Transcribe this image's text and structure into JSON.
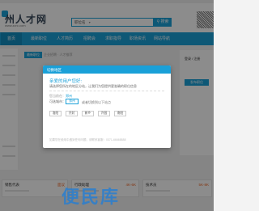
{
  "header": {
    "logo_text": "州人才网",
    "logo_url": "www.zzrc.com",
    "search_select": "职位名",
    "search_button": "搜索"
  },
  "nav": {
    "items": [
      "首页",
      "最新职位",
      "人才简历",
      "招聘会",
      "求职指导",
      "职场资讯",
      "网站导航"
    ]
  },
  "page": {
    "banner_tab": "最新职位",
    "banner_tab2": "企业招聘 · 人才推荐",
    "right_title": "登录 / 注册",
    "right_button": "发布职位"
  },
  "cards": [
    {
      "title": "销售代表",
      "salary": "面议"
    },
    {
      "title": "行政助理",
      "salary": "4K-6K"
    },
    {
      "title": "技术员",
      "salary": "5K-8K"
    }
  ],
  "dialog": {
    "title": "切换地区",
    "question": "亲爱的用户您好:",
    "description": "请选择您所在的地区分站，让我们为您提供更准确的职位信息",
    "current_label": "您当前在：",
    "current_city": "郑州",
    "city_label": "可选城市：",
    "selected_city": "郑州",
    "hint": "或者切换到以下站点",
    "other_cities": [
      "洛阳",
      "开封",
      "新乡",
      "许昌",
      "南阳"
    ],
    "footer": "如果您在使用中遇到任何问题，请联系客服：0371-66668888"
  },
  "watermark": "便民库"
}
